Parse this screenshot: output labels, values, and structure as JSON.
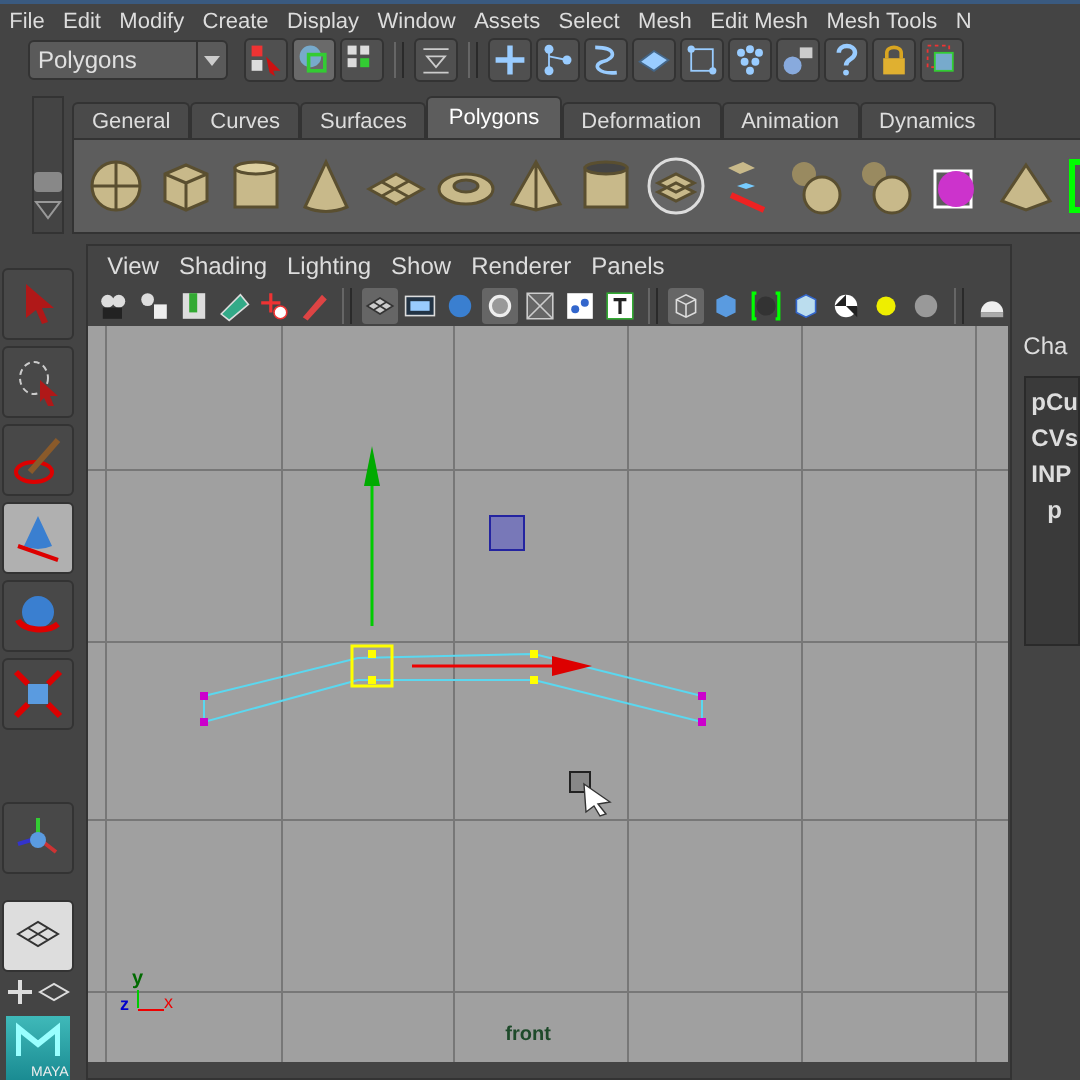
{
  "menu_bar": {
    "items": [
      "File",
      "Edit",
      "Modify",
      "Create",
      "Display",
      "Window",
      "Assets",
      "Select",
      "Mesh",
      "Edit Mesh",
      "Mesh Tools",
      "N"
    ]
  },
  "status_line": {
    "menu_set": "Polygons"
  },
  "shelf": {
    "tabs": [
      {
        "label": "General",
        "selected": false
      },
      {
        "label": "Curves",
        "selected": false
      },
      {
        "label": "Surfaces",
        "selected": false
      },
      {
        "label": "Polygons",
        "selected": true
      },
      {
        "label": "Deformation",
        "selected": false
      },
      {
        "label": "Animation",
        "selected": false
      },
      {
        "label": "Dynamics",
        "selected": false
      }
    ]
  },
  "toolbox": {
    "tools": [
      {
        "selected": false
      },
      {
        "selected": false
      },
      {
        "selected": false
      },
      {
        "selected": true
      },
      {
        "selected": false
      },
      {
        "selected": false
      }
    ],
    "logo": "MAYA"
  },
  "panel": {
    "menu": [
      "View",
      "Shading",
      "Lighting",
      "Show",
      "Renderer",
      "Panels"
    ],
    "viewport": {
      "camera": "front",
      "axes": {
        "y": "y",
        "z": "z",
        "x": "x"
      }
    }
  },
  "channel_box": {
    "title": "Cha",
    "lines": [
      "pCu",
      "CVs",
      "INP",
      "p"
    ]
  }
}
